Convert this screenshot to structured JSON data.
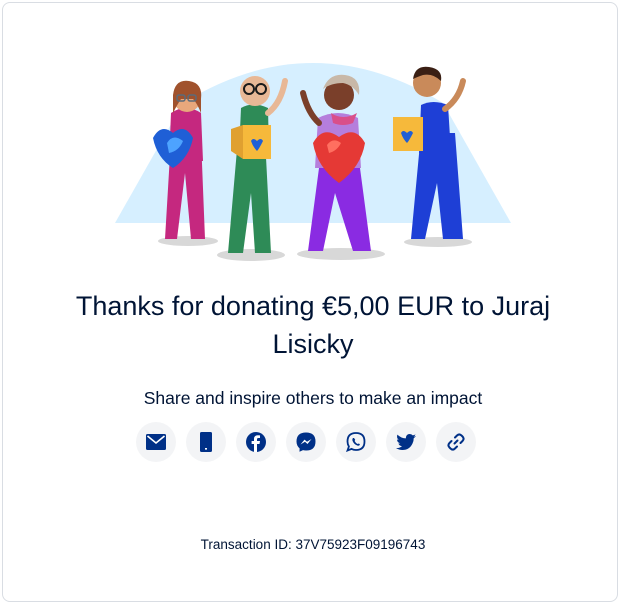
{
  "headline": "Thanks for donating €5,00 EUR to Juraj Lisicky",
  "subtitle": "Share and inspire others to make an impact",
  "share_buttons": [
    {
      "icon": "envelope-icon",
      "name": "email"
    },
    {
      "icon": "mobile-phone-icon",
      "name": "text-message"
    },
    {
      "icon": "facebook-icon",
      "name": "facebook"
    },
    {
      "icon": "messenger-icon",
      "name": "messenger"
    },
    {
      "icon": "whatsapp-icon",
      "name": "whatsapp"
    },
    {
      "icon": "twitter-icon",
      "name": "twitter"
    },
    {
      "icon": "link-icon",
      "name": "copy-link"
    }
  ],
  "transaction": {
    "label": "Transaction ID: 37V75923F09196743"
  },
  "colors": {
    "text": "#001435",
    "icon": "#003087",
    "button_bg": "#f3f4f6",
    "illustration_bg": "#d6efff"
  }
}
